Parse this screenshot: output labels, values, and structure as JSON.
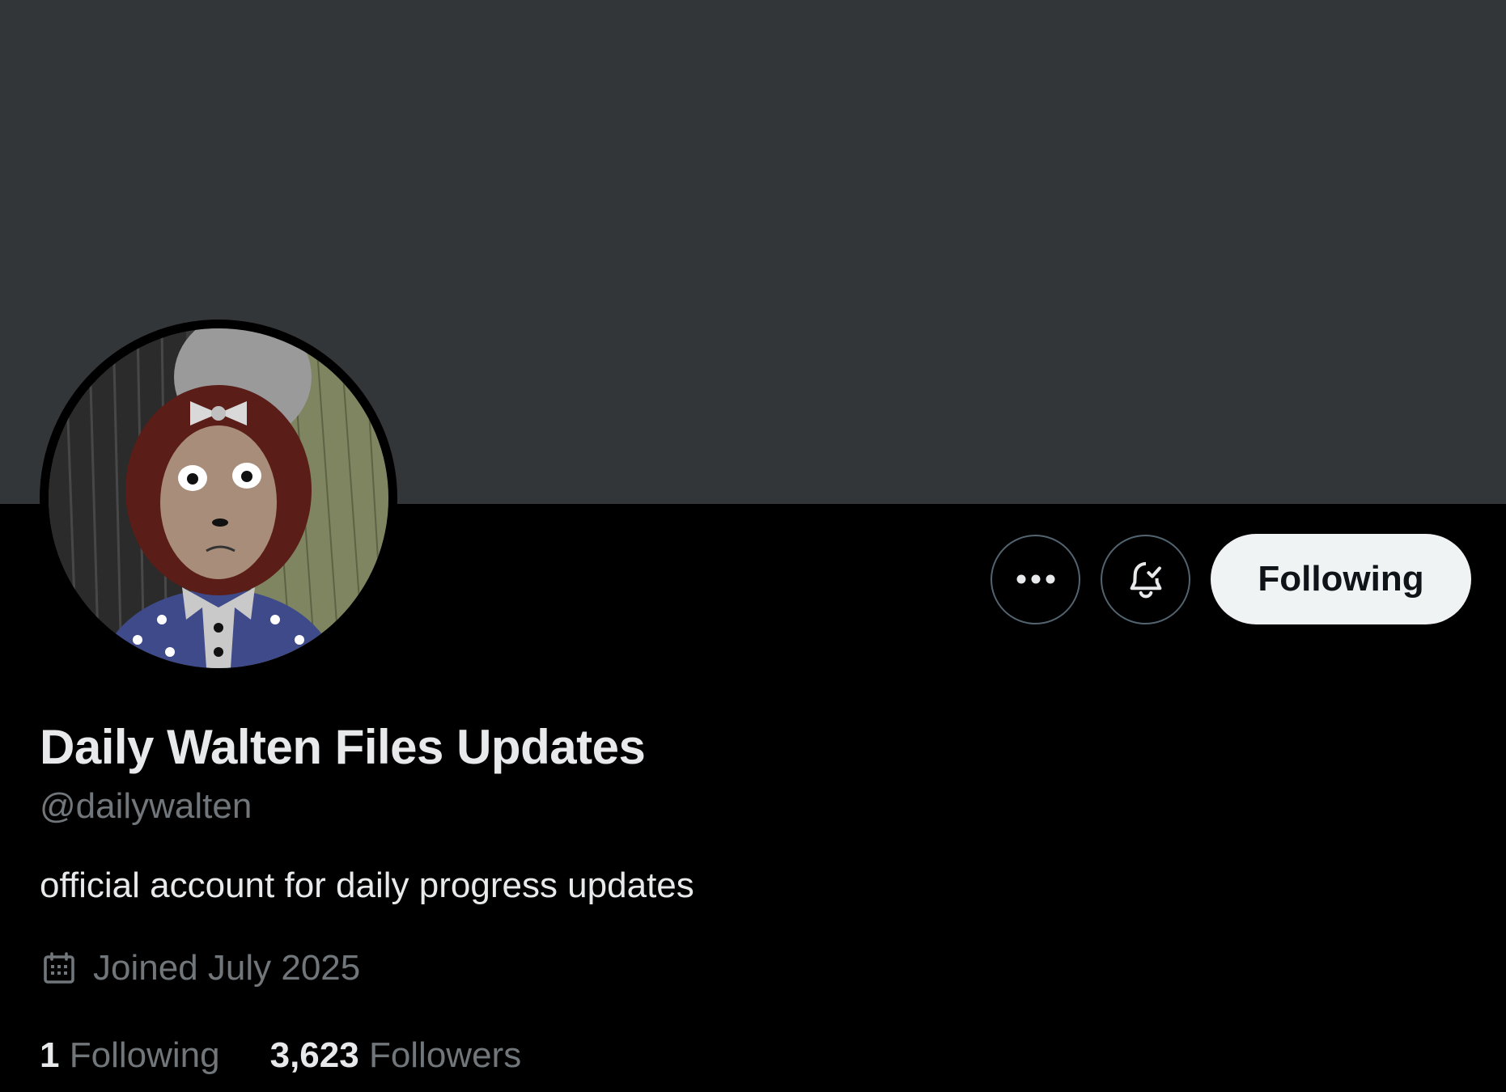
{
  "profile": {
    "display_name": "Daily Walten Files Updates",
    "handle": "@dailywalten",
    "bio": "official account for daily progress updates",
    "joined": "Joined July 2025"
  },
  "actions": {
    "more_icon": "more-horizontal-icon",
    "notify_icon": "bell-check-icon",
    "following_label": "Following"
  },
  "stats": {
    "following_count": "1",
    "following_label": "Following",
    "followers_count": "3,623",
    "followers_label": "Followers"
  },
  "colors": {
    "background": "#000000",
    "banner": "#333639",
    "primary_text": "#e7e9ea",
    "secondary_text": "#71767b",
    "button_border": "#536471",
    "following_button_bg": "#eff3f4"
  }
}
